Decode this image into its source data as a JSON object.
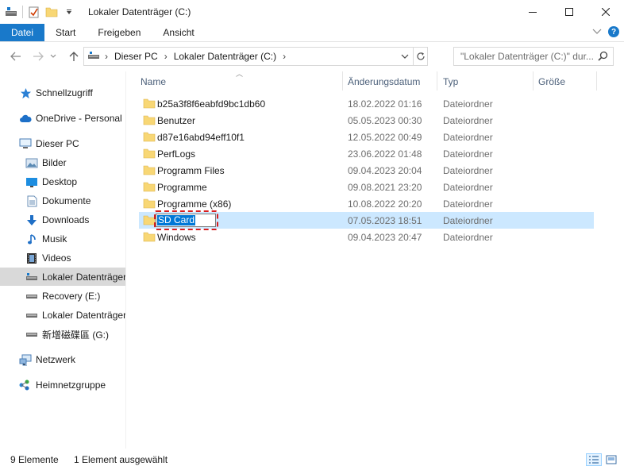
{
  "window": {
    "title": "Lokaler Datenträger (C:)",
    "controls": {
      "minimize_icon": "minimize-icon",
      "maximize_icon": "maximize-icon",
      "close_icon": "close-icon"
    }
  },
  "ribbon": {
    "tabs": [
      "Datei",
      "Start",
      "Freigeben",
      "Ansicht"
    ],
    "file_tab_color": "#1979ca",
    "help_label": "?"
  },
  "address": {
    "crumbs": [
      "Dieser PC",
      "Lokaler Datenträger (C:)"
    ],
    "search_placeholder": "\"Lokaler Datenträger (C:)\" dur..."
  },
  "navigation": {
    "items": [
      {
        "label": "Schnellzugriff",
        "icon": "star-icon"
      },
      {
        "label": "OneDrive - Personal",
        "icon": "cloud-icon"
      },
      {
        "label": "Dieser PC",
        "icon": "computer-icon"
      },
      {
        "label": "Bilder",
        "icon": "pictures-icon"
      },
      {
        "label": "Desktop",
        "icon": "desktop-icon"
      },
      {
        "label": "Dokumente",
        "icon": "documents-icon"
      },
      {
        "label": "Downloads",
        "icon": "download-icon"
      },
      {
        "label": "Musik",
        "icon": "music-icon"
      },
      {
        "label": "Videos",
        "icon": "video-icon"
      },
      {
        "label": "Lokaler Datenträger",
        "icon": "system-drive-icon",
        "selected": true
      },
      {
        "label": "Recovery (E:)",
        "icon": "drive-icon"
      },
      {
        "label": "Lokaler Datenträger",
        "icon": "drive-icon"
      },
      {
        "label": "新增磁碟區 (G:)",
        "icon": "drive-icon"
      },
      {
        "label": "Netzwerk",
        "icon": "network-icon"
      },
      {
        "label": "Heimnetzgruppe",
        "icon": "homegroup-icon"
      }
    ]
  },
  "columns": [
    "Name",
    "Änderungsdatum",
    "Typ",
    "Größe"
  ],
  "files": [
    {
      "name": "b25a3f8f6eabfd9bc1db60",
      "date": "18.02.2022 01:16",
      "type": "Dateiordner"
    },
    {
      "name": "Benutzer",
      "date": "05.05.2023 00:30",
      "type": "Dateiordner"
    },
    {
      "name": "d87e16abd94eff10f1",
      "date": "12.05.2022 00:49",
      "type": "Dateiordner"
    },
    {
      "name": "PerfLogs",
      "date": "23.06.2022 01:48",
      "type": "Dateiordner"
    },
    {
      "name": "Programm Files",
      "date": "09.04.2023 20:04",
      "type": "Dateiordner"
    },
    {
      "name": "Programme",
      "date": "09.08.2021 23:20",
      "type": "Dateiordner"
    },
    {
      "name": "Programme (x86)",
      "date": "10.08.2022 20:20",
      "type": "Dateiordner"
    },
    {
      "name": "SD Card",
      "date": "07.05.2023 18:51",
      "type": "Dateiordner",
      "selected": true,
      "renaming": true
    },
    {
      "name": "Windows",
      "date": "09.04.2023 20:47",
      "type": "Dateiordner"
    }
  ],
  "status": {
    "count": "9 Elemente",
    "selection": "1 Element ausgewählt"
  },
  "colors": {
    "selection_bg": "#cce8ff",
    "nav_selected_bg": "#d9d9d9",
    "folder": "#f8d775",
    "highlight_mark": "#d81e1e"
  }
}
